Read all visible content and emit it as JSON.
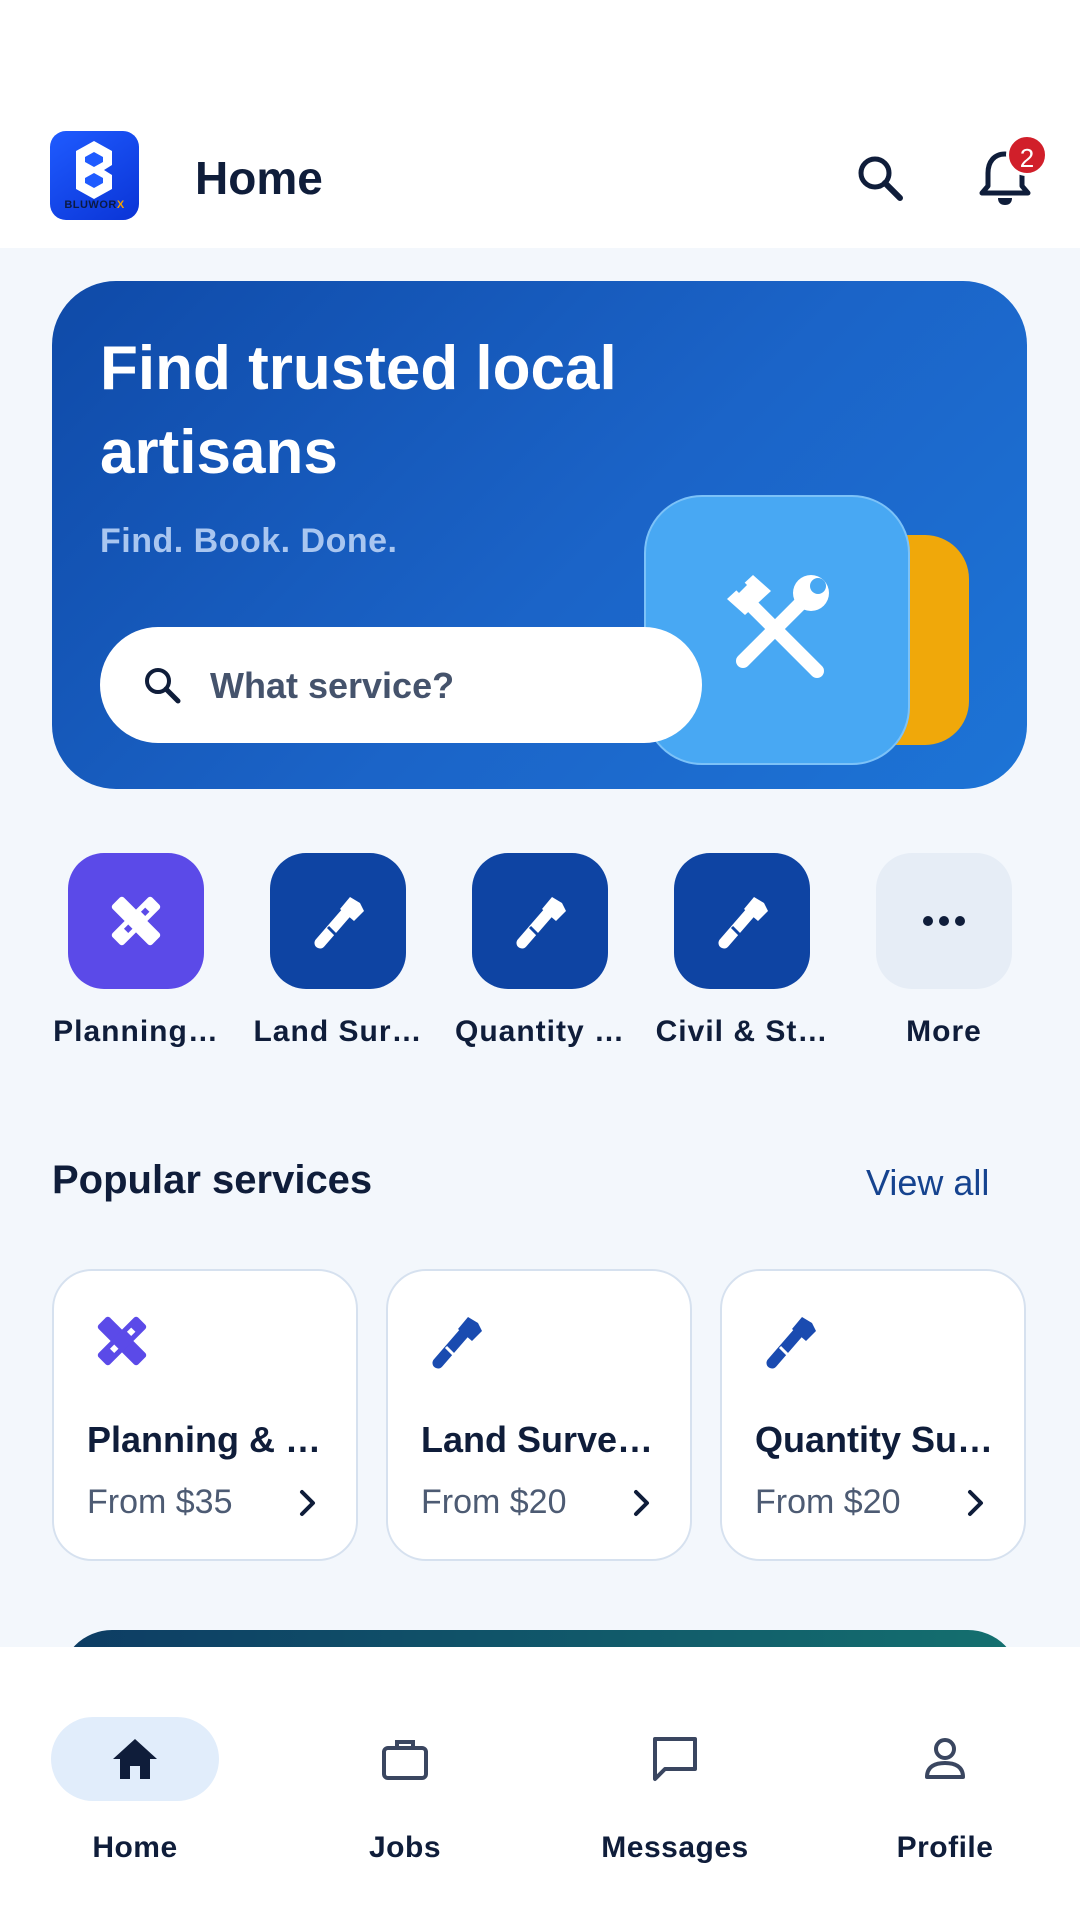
{
  "app_bar": {
    "title": "Home",
    "logo_text": "BLUWOR",
    "logo_text_accent": "X",
    "notification_count": "2"
  },
  "hero": {
    "title": "Find trusted local artisans",
    "subtitle": "Find. Book. Done.",
    "search_placeholder": "What service?"
  },
  "categories": [
    {
      "label": "Planning…",
      "icon": "ruler-pencil-icon"
    },
    {
      "label": "Land Sur…",
      "icon": "wrench-icon"
    },
    {
      "label": "Quantity …",
      "icon": "wrench-icon"
    },
    {
      "label": "Civil & St…",
      "icon": "wrench-icon"
    },
    {
      "label": "More",
      "icon": "more-icon"
    }
  ],
  "popular": {
    "title": "Popular services",
    "view_all": "View all",
    "cards": [
      {
        "title": "Planning & …",
        "price": "From $35",
        "icon": "ruler-pencil-icon"
      },
      {
        "title": "Land Surve…",
        "price": "From $20",
        "icon": "wrench-icon"
      },
      {
        "title": "Quantity Su…",
        "price": "From $20",
        "icon": "wrench-icon"
      }
    ]
  },
  "nav": [
    {
      "label": "Home",
      "icon": "home-icon",
      "active": true
    },
    {
      "label": "Jobs",
      "icon": "briefcase-icon",
      "active": false
    },
    {
      "label": "Messages",
      "icon": "message-icon",
      "active": false
    },
    {
      "label": "Profile",
      "icon": "profile-icon",
      "active": false
    }
  ],
  "colors": {
    "primary": "#0e44a3",
    "accent_purple": "#5b4ae8",
    "badge": "#d11f2a",
    "background": "#f3f7fc"
  }
}
